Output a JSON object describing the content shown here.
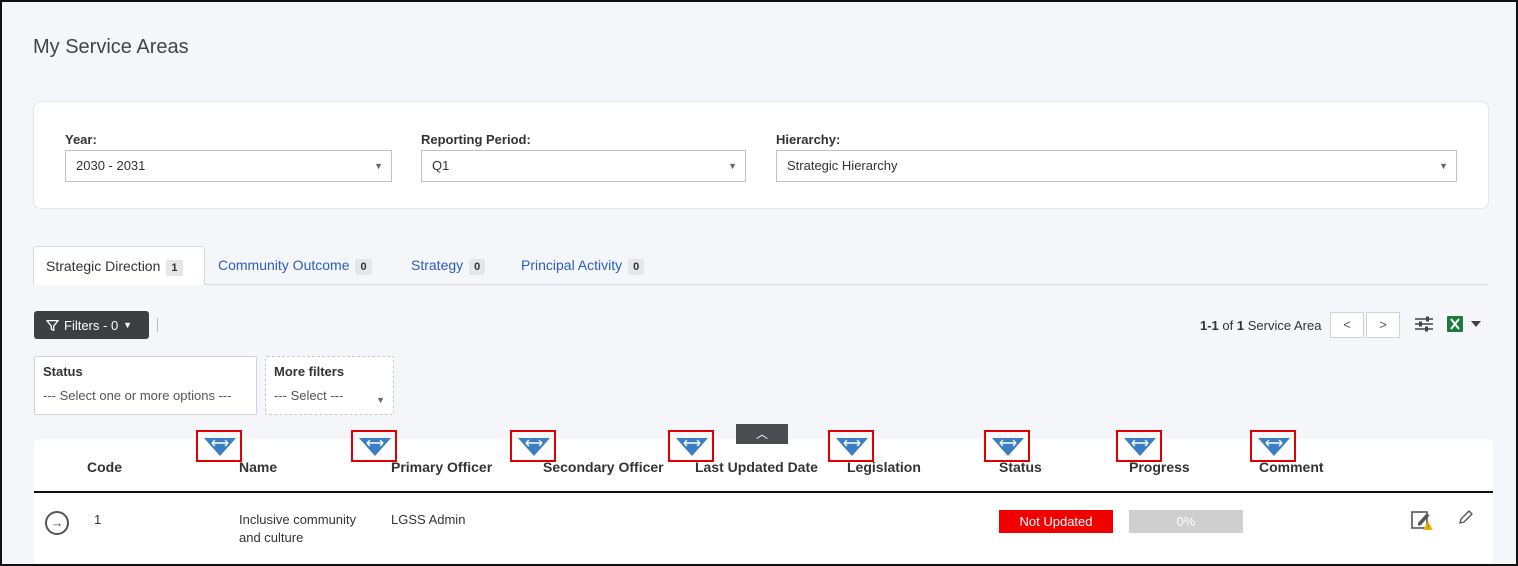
{
  "page": {
    "title": "My Service Areas"
  },
  "filters_card": {
    "year": {
      "label": "Year:",
      "value": "2030 - 2031"
    },
    "period": {
      "label": "Reporting Period:",
      "value": "Q1"
    },
    "hierarchy": {
      "label": "Hierarchy:",
      "value": "Strategic Hierarchy"
    }
  },
  "tabs": [
    {
      "label": "Strategic Direction",
      "count": "1"
    },
    {
      "label": "Community Outcome",
      "count": "0"
    },
    {
      "label": "Strategy",
      "count": "0"
    },
    {
      "label": "Principal Activity",
      "count": "0"
    }
  ],
  "toolbar": {
    "filters_label": "Filters - 0",
    "pager_range": "1-1",
    "pager_of": "of",
    "pager_total": "1",
    "pager_unit": "Service Area"
  },
  "filter_boxes": {
    "status": {
      "label": "Status",
      "placeholder": "--- Select one or more options ---"
    },
    "more": {
      "label": "More filters",
      "placeholder": "--- Select ---"
    }
  },
  "table": {
    "headers": [
      "Code",
      "Name",
      "Primary Officer",
      "Secondary Officer",
      "Last Updated Date",
      "Legislation",
      "Status",
      "Progress",
      "Comment"
    ],
    "rows": [
      {
        "code": "1",
        "name": "Inclusive community and culture",
        "primary_officer": "LGSS Admin",
        "secondary_officer": "",
        "last_updated": "",
        "legislation": "",
        "status": "Not Updated",
        "progress_label": "0%",
        "progress": 0,
        "comment": ""
      }
    ]
  },
  "colors": {
    "status_not_updated": "#f00000",
    "link_blue": "#2a5cc4",
    "marker_red": "#e00000",
    "marker_blue": "#3a7fc4"
  }
}
